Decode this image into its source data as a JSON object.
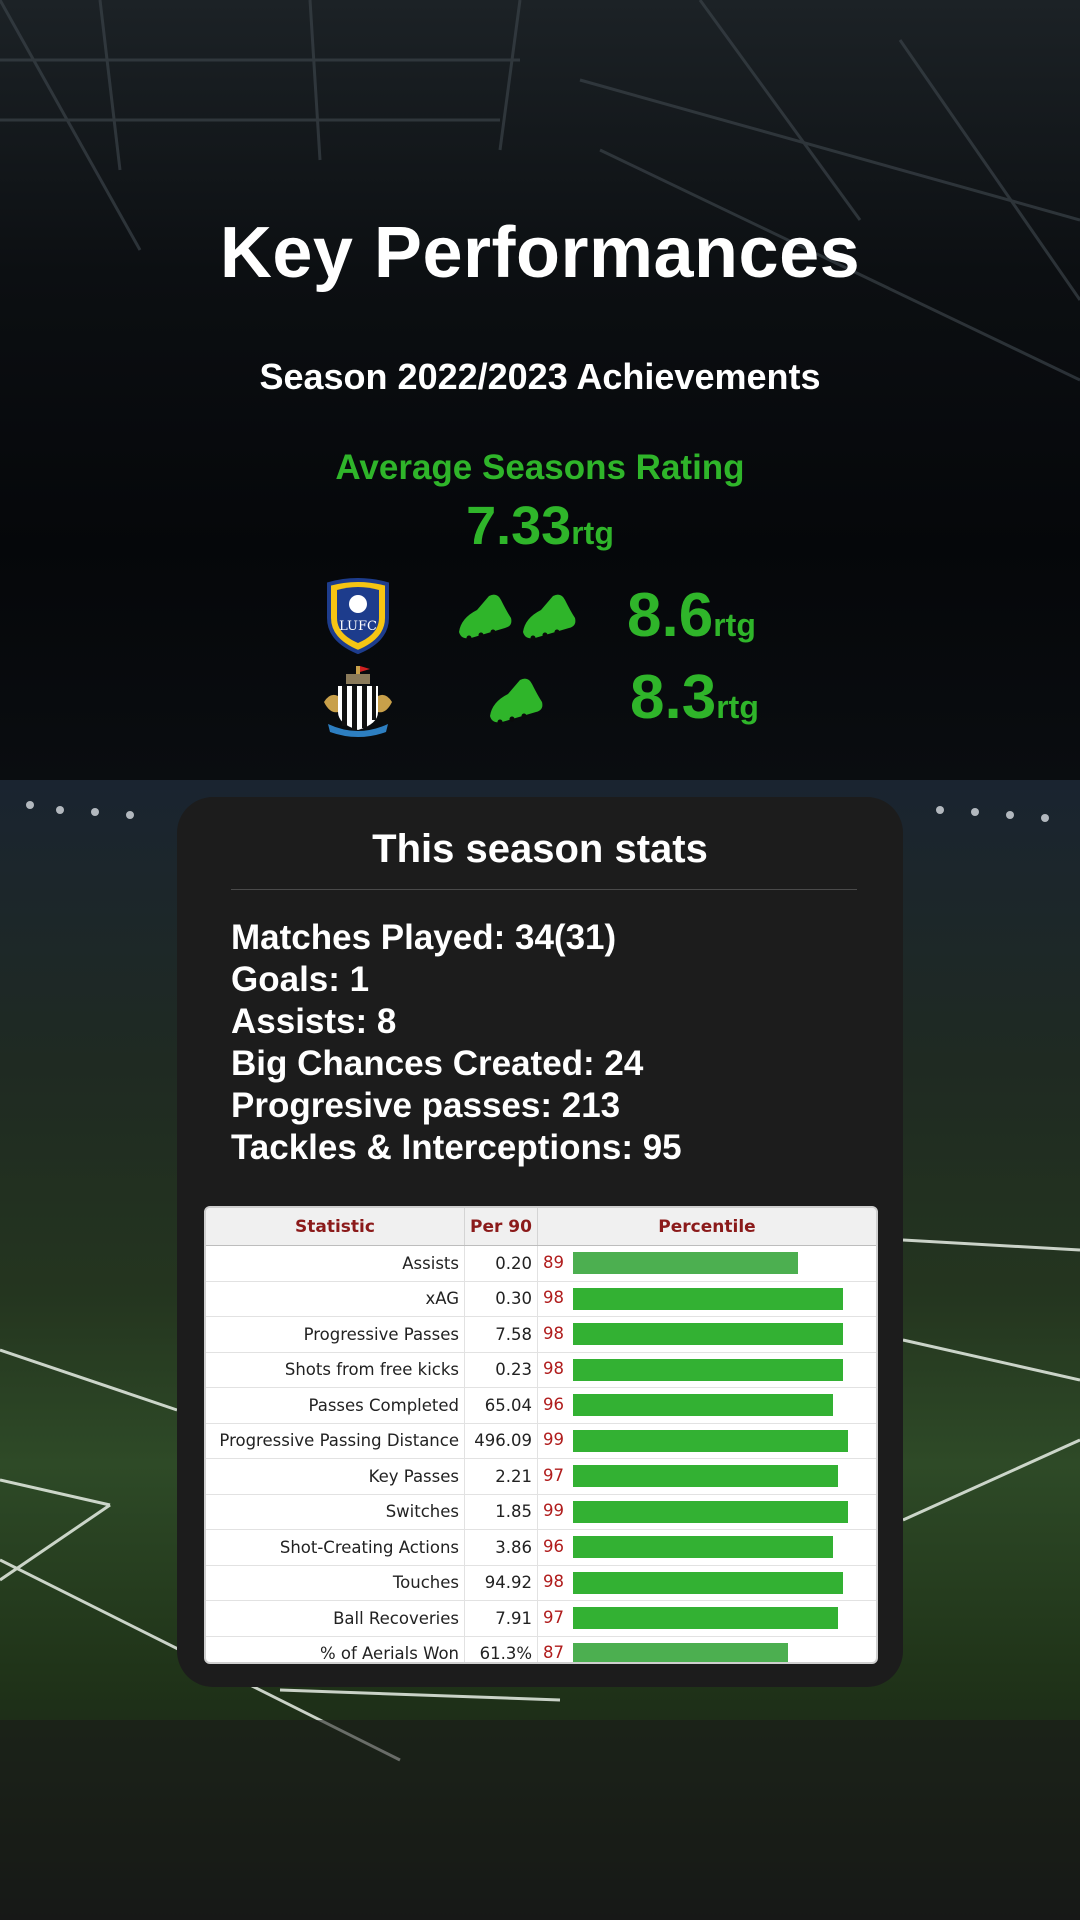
{
  "header": {
    "title": "Key Performances",
    "subtitle": "Season 2022/2023 Achievements"
  },
  "average": {
    "label": "Average Seasons Rating",
    "value": "7.33",
    "unit": "rtg"
  },
  "highlights": [
    {
      "club_icon": "leeds-united-crest-icon",
      "boots": 2,
      "value": "8.6",
      "unit": "rtg"
    },
    {
      "club_icon": "newcastle-united-crest-icon",
      "boots": 1,
      "value": "8.3",
      "unit": "rtg"
    }
  ],
  "stats_card": {
    "title": "This season stats",
    "lines": [
      "Matches Played: 34(31)",
      "Goals: 1",
      "Assists: 8",
      "Big Chances Created: 24",
      "Progresive passes: 213",
      "Tackles & Interceptions: 95"
    ]
  },
  "table": {
    "headers": [
      "Statistic",
      "Per 90",
      "Percentile"
    ],
    "rows": [
      {
        "statistic": "Assists",
        "per90": "0.20",
        "percentile": "89"
      },
      {
        "statistic": "xAG",
        "per90": "0.30",
        "percentile": "98"
      },
      {
        "statistic": "Progressive Passes",
        "per90": "7.58",
        "percentile": "98"
      },
      {
        "statistic": "Shots from free kicks",
        "per90": "0.23",
        "percentile": "98"
      },
      {
        "statistic": "Passes Completed",
        "per90": "65.04",
        "percentile": "96"
      },
      {
        "statistic": "Progressive Passing Distance",
        "per90": "496.09",
        "percentile": "99"
      },
      {
        "statistic": "Key Passes",
        "per90": "2.21",
        "percentile": "97"
      },
      {
        "statistic": "Switches",
        "per90": "1.85",
        "percentile": "99"
      },
      {
        "statistic": "Shot-Creating Actions",
        "per90": "3.86",
        "percentile": "96"
      },
      {
        "statistic": "Touches",
        "per90": "94.92",
        "percentile": "98"
      },
      {
        "statistic": "Ball Recoveries",
        "per90": "7.91",
        "percentile": "97"
      },
      {
        "statistic": "% of Aerials Won",
        "per90": "61.3%",
        "percentile": "87"
      }
    ]
  },
  "colors": {
    "accent_green": "#2fb52a",
    "bar_high": "#33b133",
    "bar_mid": "#4caf50",
    "percentile_text": "#b01c1c",
    "header_text": "#8b1a1a"
  }
}
